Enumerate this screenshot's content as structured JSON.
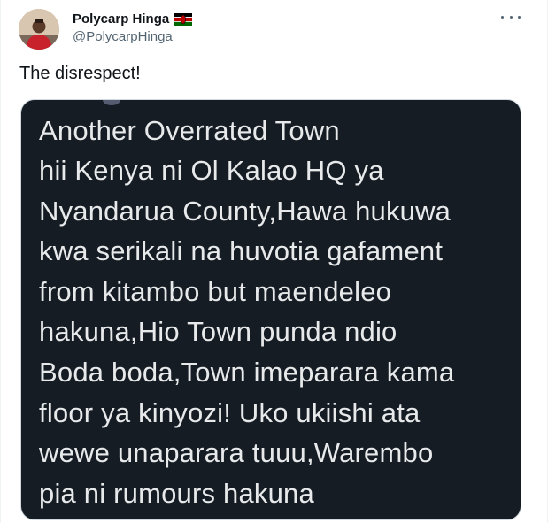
{
  "author": {
    "display_name": "Polycarp Hinga",
    "handle": "@PolycarpHinga",
    "flag": "kenya-flag"
  },
  "tweet": {
    "text": "The disrespect!",
    "more_icon": "more-horizontal-icon"
  },
  "media": {
    "lines": [
      "Another Overrated Town",
      "hii Kenya ni Ol Kalao HQ ya",
      "Nyandarua County,Hawa hukuwa",
      "kwa serikali na huvotia gafament",
      "from kitambo but maendeleo",
      "hakuna,Hio Town punda ndio",
      "Boda boda,Town imeparara kama",
      "floor ya kinyozi! Uko ukiishi ata",
      "wewe unaparara tuuu,Warembo",
      "pia ni rumours hakuna"
    ],
    "background": "#151c24",
    "text_color": "#e7e9ea"
  }
}
